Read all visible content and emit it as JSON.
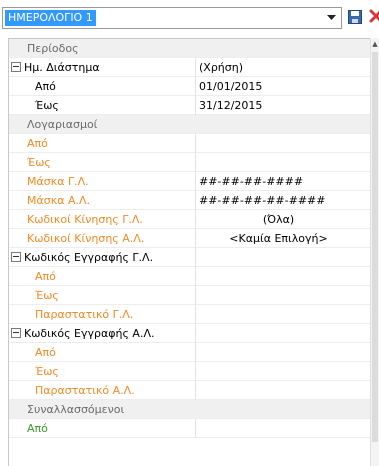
{
  "toolbar": {
    "selected_profile": "ΗΜΕΡΟΛΟΓΙΟ 1",
    "icons": {
      "dropdown": "chevron-down-icon",
      "save": "save-icon",
      "delete": "delete-icon"
    }
  },
  "grid": {
    "period": {
      "title": "Περίοδος",
      "range_label": "Ημ. Διάστημα",
      "range_value": "(Χρήση)",
      "from_label": "Από",
      "from_value": "01/01/2015",
      "to_label": "Έως",
      "to_value": "31/12/2015"
    },
    "accounts": {
      "title": "Λογαριασμοί",
      "from_label": "Από",
      "to_label": "Έως",
      "gl_mask_label": "Μάσκα Γ.Λ.",
      "gl_mask_value": "##-##-##-####",
      "al_mask_label": "Μάσκα Α.Λ.",
      "al_mask_value": "##-##-##-##-####",
      "gl_codes_label": "Κωδικοί Κίνησης Γ.Λ.",
      "gl_codes_value": "(Όλα)",
      "al_codes_label": "Κωδικοί Κίνησης Α.Λ.",
      "al_codes_value": "<Καμία Επιλογή>"
    },
    "gl_entry": {
      "title": "Κωδικός Εγγραφής Γ.Λ.",
      "from_label": "Από",
      "to_label": "Έως",
      "doc_label": "Παραστατικό Γ.Λ."
    },
    "al_entry": {
      "title": "Κωδικός Εγγραφής Α.Λ.",
      "from_label": "Από",
      "to_label": "Έως",
      "doc_label": "Παραστατικό Α.Λ."
    },
    "partners": {
      "title": "Συναλλασσόμενοι",
      "from_label": "Από"
    }
  },
  "colors": {
    "selection": "#3399ff",
    "orange_label": "#f08a24",
    "green_label": "#3a9b2a",
    "category_bg": "#f0f0f0"
  }
}
